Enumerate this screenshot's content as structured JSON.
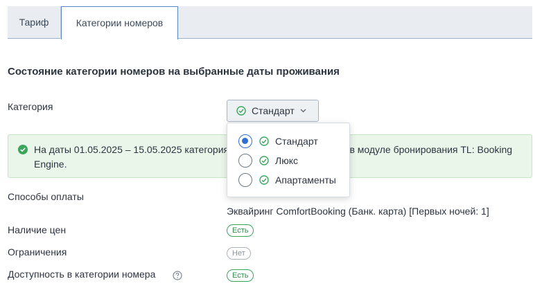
{
  "tabs": [
    {
      "label": "Тариф"
    },
    {
      "label": "Категории номеров"
    }
  ],
  "section_title": "Состояние категории номеров на выбранные даты проживания",
  "category": {
    "label": "Категория",
    "selected": "Стандарт",
    "options": [
      {
        "label": "Стандарт",
        "checked": true
      },
      {
        "label": "Люкс",
        "checked": false
      },
      {
        "label": "Апартаменты",
        "checked": false
      }
    ]
  },
  "alert": {
    "text": "На даты 01.05.2025 – 15.05.2025 категория номеров доступна гостям в модуле бронирования TL: Booking Engine."
  },
  "payment": {
    "label": "Способы оплаты",
    "value": "Эквайринг ComfortBooking (Банк. карта) [Первых ночей: 1]"
  },
  "prices": {
    "label": "Наличие цен",
    "badge": "Есть"
  },
  "restrictions": {
    "label": "Ограничения",
    "badge": "Нет"
  },
  "availability": {
    "label": "Доступность в категории номера",
    "badge": "Есть"
  },
  "colors": {
    "accent": "#2f6fd1",
    "success": "#3ca55c",
    "alert_bg": "#eaf6ea"
  },
  "icons": {
    "option_status": "check-circle-icon",
    "alert": "check-circle-filled-icon",
    "help": "question-circle-icon",
    "dropdown": "chevron-down-icon"
  }
}
